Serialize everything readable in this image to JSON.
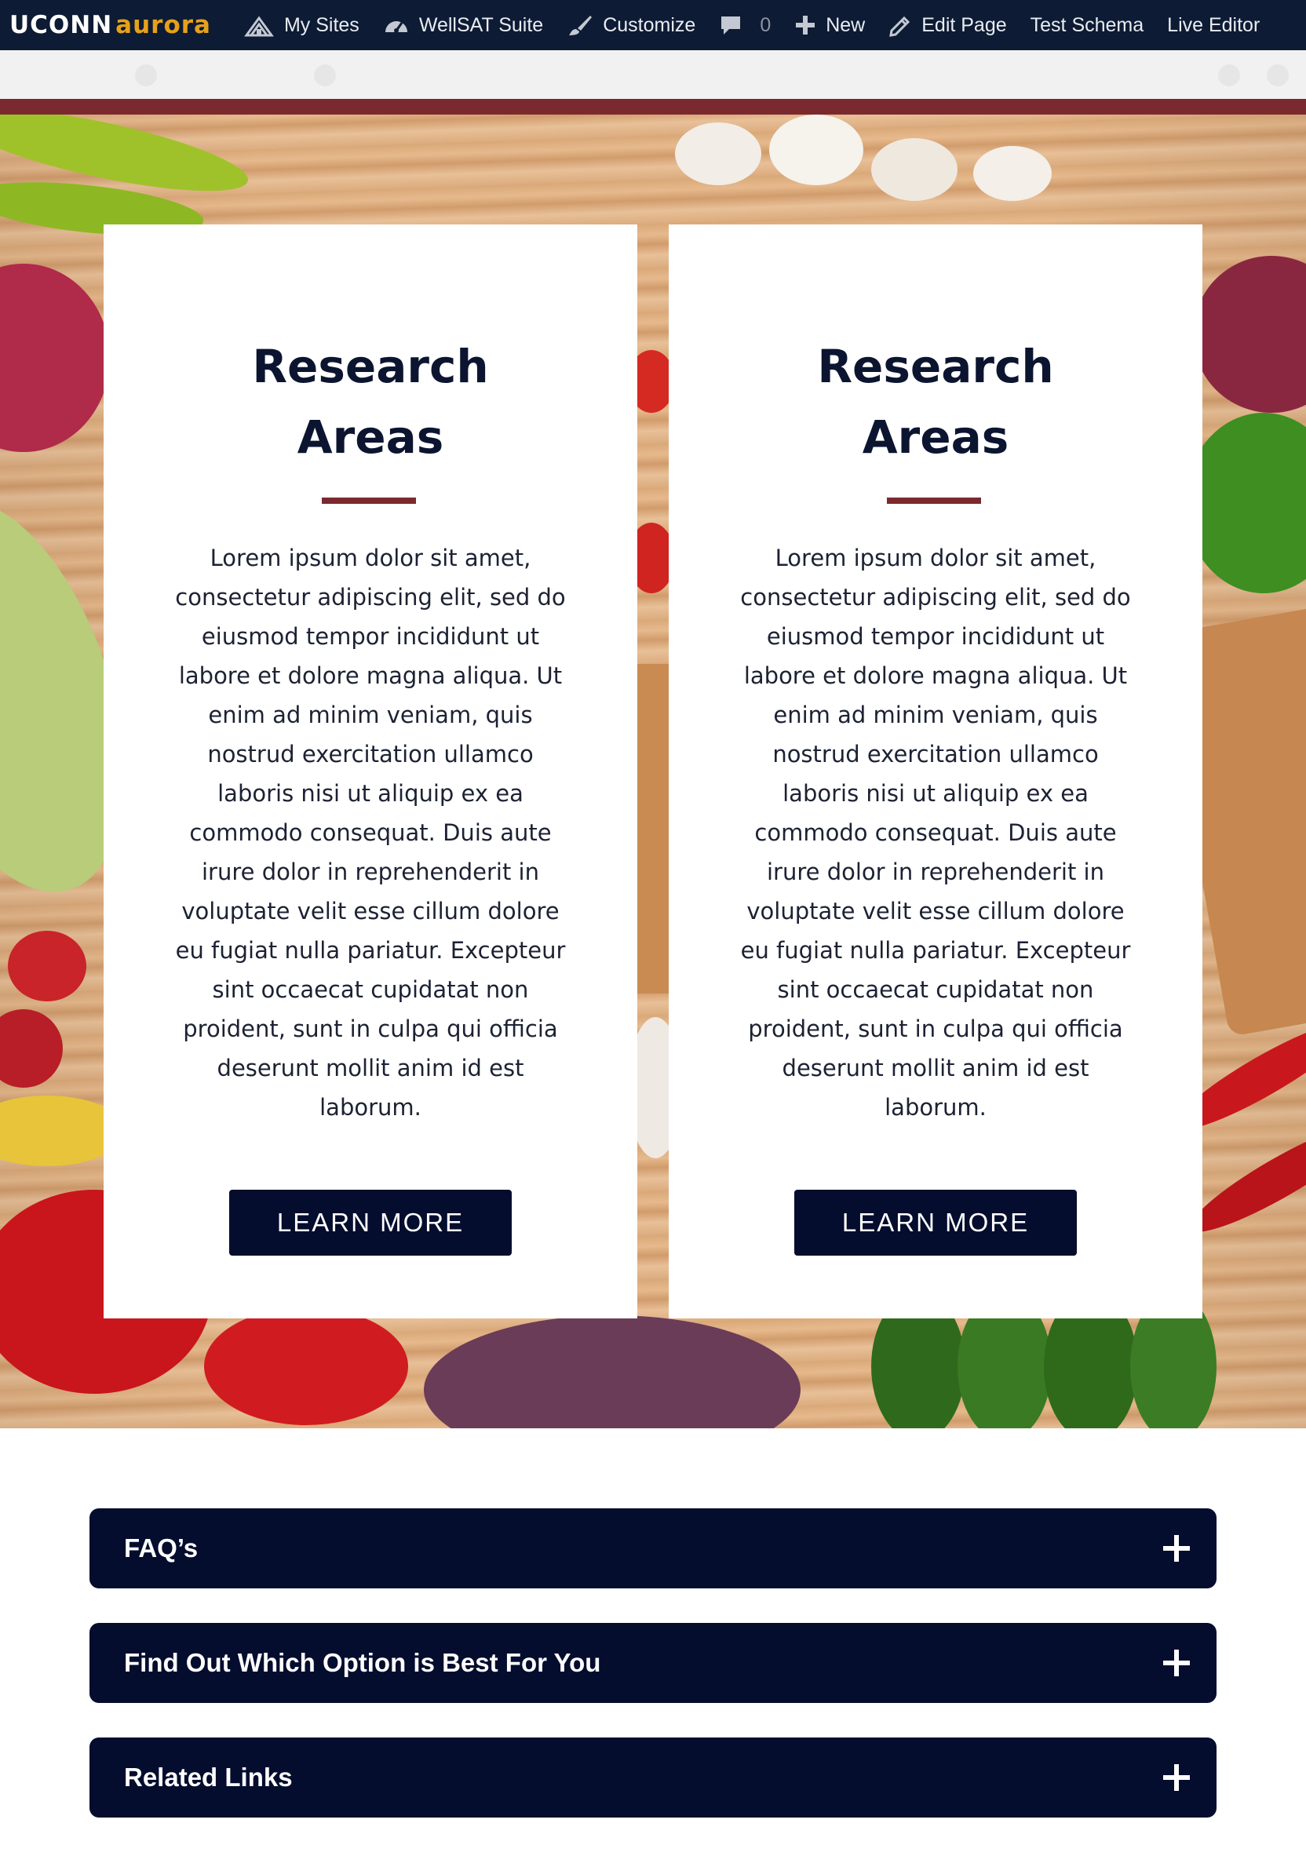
{
  "adminbar": {
    "brand_uconn": "UCONN",
    "brand_aurora": "aurora",
    "items": [
      {
        "label": "My Sites",
        "icon": "my-sites-icon"
      },
      {
        "label": "WellSAT Suite",
        "icon": "dashboard-icon"
      },
      {
        "label": "Customize",
        "icon": "paintbrush-icon"
      },
      {
        "label": "0",
        "icon": "comment-icon"
      },
      {
        "label": "New",
        "icon": "plus-icon"
      },
      {
        "label": "Edit Page",
        "icon": "pencil-icon"
      },
      {
        "label": "Test Schema",
        "icon": ""
      },
      {
        "label": "Live Editor",
        "icon": ""
      }
    ]
  },
  "colors": {
    "adminbar_bg": "#0d1b34",
    "accent_maroon": "#7a2a2e",
    "navy_button": "#050d2e",
    "brand_gold": "#e6a11b"
  },
  "cards": [
    {
      "title": "Research Areas",
      "body": "Lorem ipsum dolor sit amet, consectetur adipiscing elit, sed do eiusmod tempor incididunt ut labore et dolore magna aliqua. Ut enim ad minim veniam, quis nostrud exercitation ullamco laboris nisi ut aliquip ex ea commodo consequat. Duis aute irure dolor in reprehenderit in voluptate velit esse cillum dolore eu fugiat nulla pariatur. Excepteur sint occaecat cupidatat non proident, sunt in culpa qui officia deserunt mollit anim id est laborum.",
      "button": "LEARN MORE"
    },
    {
      "title": "Research Areas",
      "body": "Lorem ipsum dolor sit amet, consectetur adipiscing elit, sed do eiusmod tempor incididunt ut labore et dolore magna aliqua. Ut enim ad minim veniam, quis nostrud exercitation ullamco laboris nisi ut aliquip ex ea commodo consequat. Duis aute irure dolor in reprehenderit in voluptate velit esse cillum dolore eu fugiat nulla pariatur. Excepteur sint occaecat cupidatat non proident, sunt in culpa qui officia deserunt mollit anim id est laborum.",
      "button": "LEARN MORE"
    }
  ],
  "accordions": [
    {
      "title": "FAQ’s"
    },
    {
      "title": "Find Out Which Option is Best For You"
    },
    {
      "title": "Related Links"
    }
  ]
}
